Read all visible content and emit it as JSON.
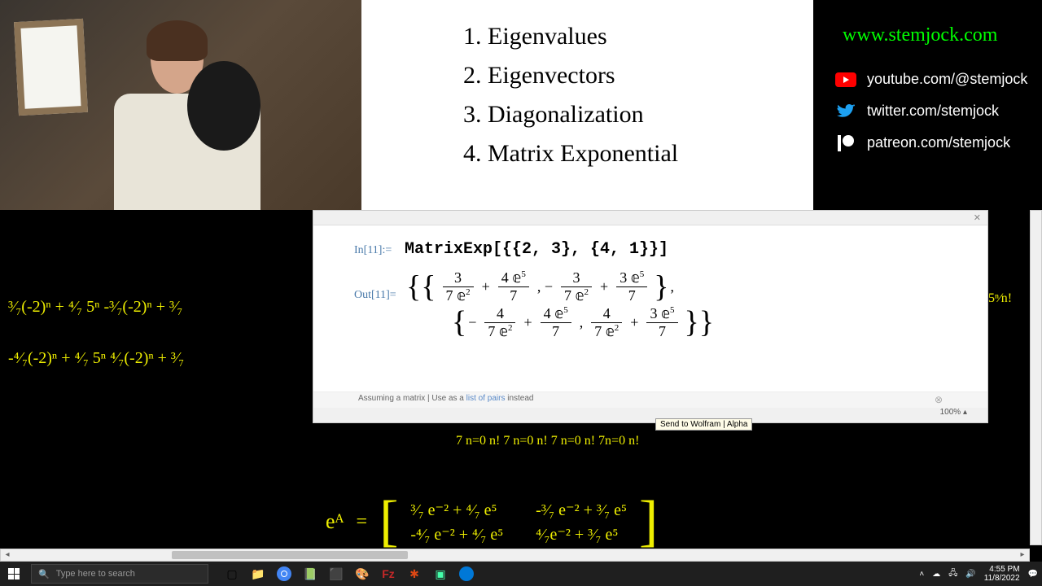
{
  "topics": {
    "t1": "1. Eigenvalues",
    "t2": "2. Eigenvectors",
    "t3": "3. Diagonalization",
    "t4": "4. Matrix Exponential"
  },
  "socials": {
    "website": "www.stemjock.com",
    "youtube": "youtube.com/@stemjock",
    "twitter": "twitter.com/stemjock",
    "patreon": "patreon.com/stemjock"
  },
  "mathematica": {
    "in_label": "In[11]:=",
    "in_code": "MatrixExp[{{2, 3}, {4, 1}}]",
    "out_label": "Out[11]=",
    "cells": {
      "a11_t1_num": "3",
      "a11_t1_den": "7 𝕖",
      "a11_t1_den_sup": "2",
      "a11_t2_num": "4 𝕖",
      "a11_t2_num_sup": "5",
      "a11_t2_den": "7",
      "a12_t1_num": "3",
      "a12_t1_den": "7 𝕖",
      "a12_t1_den_sup": "2",
      "a12_t2_num": "3 𝕖",
      "a12_t2_num_sup": "5",
      "a12_t2_den": "7",
      "a21_t1_num": "4",
      "a21_t1_den": "7 𝕖",
      "a21_t1_den_sup": "2",
      "a21_t2_num": "4 𝕖",
      "a21_t2_num_sup": "5",
      "a21_t2_den": "7",
      "a22_t1_num": "4",
      "a22_t1_den": "7 𝕖",
      "a22_t1_den_sup": "2",
      "a22_t2_num": "3 𝕖",
      "a22_t2_num_sup": "5",
      "a22_t2_den": "7"
    },
    "assume_prefix": "Assuming a matrix | Use as a ",
    "assume_link": "list of pairs",
    "assume_suffix": " instead",
    "tooltip": "Send to Wolfram | Alpha",
    "zoom": "100%"
  },
  "handwriting": {
    "left_line1": "³⁄₇(-2)ⁿ + ⁴⁄₇ 5ⁿ     -³⁄₇(-2)ⁿ + ³⁄₇",
    "left_line2": "-⁴⁄₇(-2)ⁿ + ⁴⁄₇ 5ⁿ    ⁴⁄₇(-2)ⁿ + ³⁄₇",
    "right_snip": "5ⁿ⁄n!",
    "bottom_snip1": "7  n=0  n!            7 n=0  n!       7 n=0 n!  7n=0 n!",
    "ea": "eᴬ",
    "eq": "=",
    "m11": "³⁄₇ e⁻² + ⁴⁄₇ e⁵",
    "m12": "-³⁄₇ e⁻² + ³⁄₇ e⁵",
    "m21": "-⁴⁄₇ e⁻² + ⁴⁄₇ e⁵",
    "m22": "⁴⁄₇e⁻² + ³⁄₇ e⁵"
  },
  "taskbar": {
    "search_placeholder": "Type here to search",
    "time": "4:55 PM",
    "date": "11/8/2022"
  }
}
